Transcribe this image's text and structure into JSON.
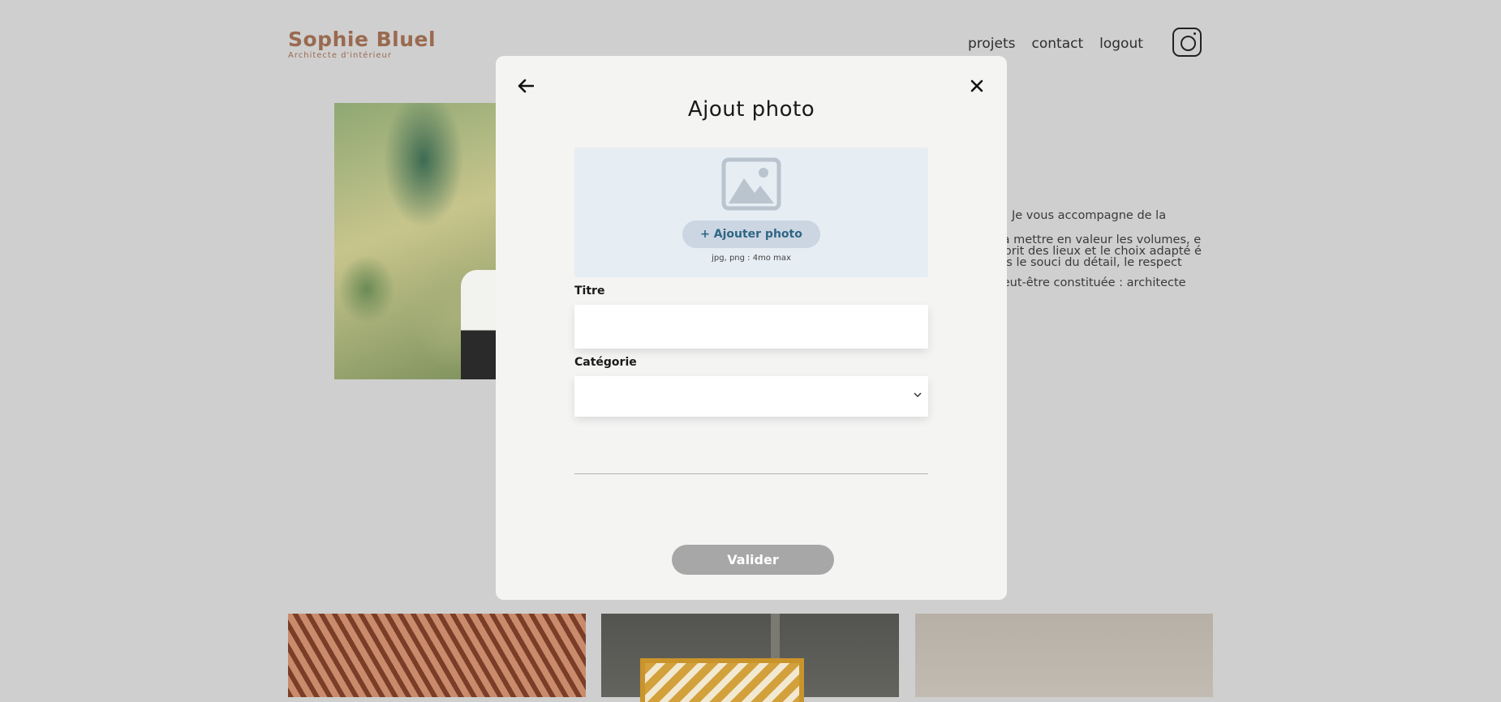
{
  "header": {
    "brand_name": "Sophie Bluel",
    "brand_subtitle": "Architecte d'intérieur",
    "nav": [
      "projets",
      "contact",
      "logout"
    ],
    "social_icon": "instagram-icon"
  },
  "about": {
    "paragraphs": [
      "Je vous accompagne de la",
      "on à mettre en valeur les volumes, e l'esprit des lieux et le choix adapté é dans le souci du détail, le respect",
      "e peut-être constituée : architecte"
    ]
  },
  "modal": {
    "back_icon": "arrow-left-icon",
    "close_icon": "close-icon",
    "title": "Ajout photo",
    "dropzone": {
      "icon": "image-placeholder-icon",
      "button_label": "+ Ajouter photo",
      "hint": "jpg, png : 4mo max"
    },
    "fields": {
      "title_label": "Titre",
      "title_value": "",
      "category_label": "Catégorie",
      "category_value": ""
    },
    "submit_label": "Valider"
  },
  "colors": {
    "brand": "#9a6a50",
    "dropzone_bg": "#e6edf3",
    "add_button_bg": "#cbd6e2",
    "add_button_text": "#306685",
    "submit_disabled": "#a7a7a7"
  }
}
